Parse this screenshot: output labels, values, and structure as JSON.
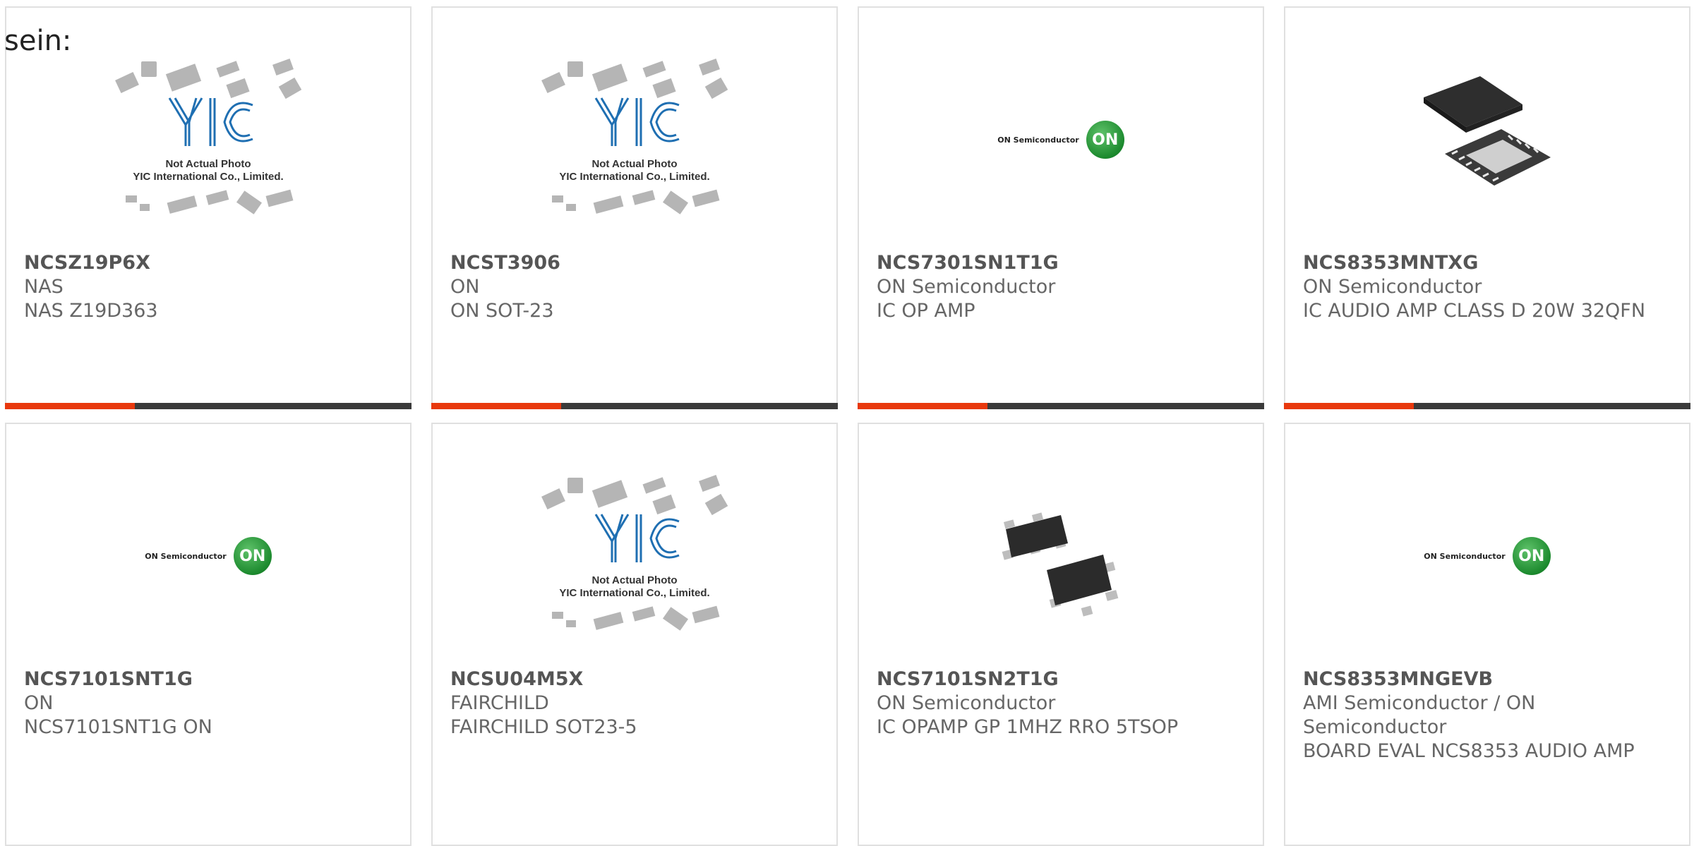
{
  "lead_text": "sein:",
  "products": [
    {
      "part": "NCSZ19P6X",
      "maker": "NAS",
      "desc": "NAS Z19D363",
      "image": "yic-placeholder",
      "image_caption": [
        "Not Actual Photo",
        "YIC International Co., Limited."
      ]
    },
    {
      "part": "NCST3906",
      "maker": "ON",
      "desc": "ON SOT-23",
      "image": "yic-placeholder",
      "image_caption": [
        "Not Actual Photo",
        "YIC International Co., Limited."
      ]
    },
    {
      "part": "NCS7301SN1T1G",
      "maker": "ON Semiconductor",
      "desc": "IC OP AMP",
      "image": "on-semiconductor-logo",
      "image_caption": [
        "ON Semiconductor",
        "ON"
      ]
    },
    {
      "part": "NCS8353MNTXG",
      "maker": "ON Semiconductor",
      "desc": "IC AUDIO AMP CLASS D 20W 32QFN",
      "image": "qfn-chip-photo"
    },
    {
      "part": "NCS7101SNT1G",
      "maker": "ON",
      "desc": "NCS7101SNT1G ON",
      "image": "on-semiconductor-logo",
      "image_caption": [
        "ON Semiconductor",
        "ON"
      ]
    },
    {
      "part": "NCSU04M5X",
      "maker": "FAIRCHILD",
      "desc": "FAIRCHILD SOT23-5",
      "image": "yic-placeholder",
      "image_caption": [
        "Not Actual Photo",
        "YIC International Co., Limited."
      ]
    },
    {
      "part": "NCS7101SN2T1G",
      "maker": "ON Semiconductor",
      "desc": "IC OPAMP GP 1MHZ RRO 5TSOP",
      "image": "tsop-chip-photo"
    },
    {
      "part": "NCS8353MNGEVB",
      "maker": "AMI Semiconductor / ON Semiconductor",
      "desc": "BOARD EVAL NCS8353 AUDIO AMP",
      "image": "on-semiconductor-logo",
      "image_caption": [
        "ON Semiconductor",
        "ON"
      ]
    }
  ],
  "colors": {
    "accent_red": "#e8380d",
    "accent_dark": "#3a3a3a",
    "on_green": "#1c8a2e",
    "yic_blue": "#1f6fb2"
  }
}
